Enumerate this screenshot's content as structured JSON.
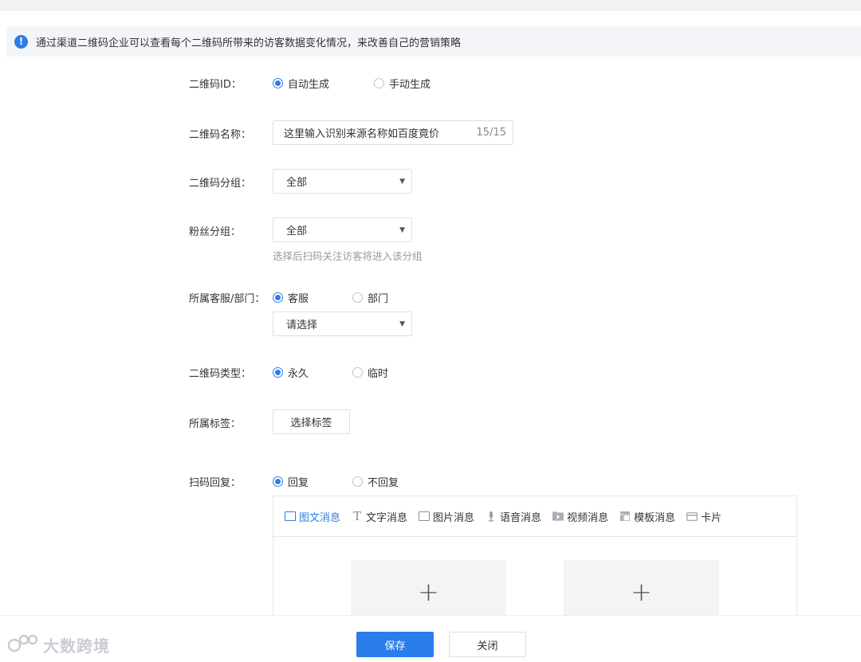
{
  "notice": {
    "text": "通过渠道二维码企业可以查看每个二维码所带来的访客数据变化情况，来改善自己的营销策略"
  },
  "form": {
    "qr_id": {
      "label": "二维码ID：",
      "options": [
        "自动生成",
        "手动生成"
      ],
      "selected": "自动生成"
    },
    "qr_name": {
      "label": "二维码名称：",
      "value": "这里输入识别来源名称如百度竟价",
      "count": "15/15"
    },
    "qr_group": {
      "label": "二维码分组：",
      "value": "全部"
    },
    "fan_group": {
      "label": "粉丝分组：",
      "value": "全部",
      "hint": "选择后扫码关注访客将进入该分组"
    },
    "service": {
      "label": "所属客服/部门：",
      "options": [
        "客服",
        "部门"
      ],
      "selected": "客服",
      "select_value": "请选择"
    },
    "qr_type": {
      "label": "二维码类型：",
      "options": [
        "永久",
        "临时"
      ],
      "selected": "永久"
    },
    "tags": {
      "label": "所属标签：",
      "button": "选择标签"
    },
    "reply": {
      "label": "扫码回复：",
      "options": [
        "回复",
        "不回复"
      ],
      "selected": "回复"
    }
  },
  "editor": {
    "tabs": [
      {
        "label": "图文消息",
        "icon": "news-icon",
        "active": true
      },
      {
        "label": "文字消息",
        "icon": "text-icon",
        "active": false
      },
      {
        "label": "图片消息",
        "icon": "image-icon",
        "active": false
      },
      {
        "label": "语音消息",
        "icon": "voice-icon",
        "active": false
      },
      {
        "label": "视频消息",
        "icon": "video-icon",
        "active": false
      },
      {
        "label": "模板消息",
        "icon": "template-icon",
        "active": false
      },
      {
        "label": "卡片",
        "icon": "card-icon",
        "active": false
      }
    ],
    "add_symbol": "+"
  },
  "footer": {
    "save": "保存",
    "close": "关闭"
  },
  "watermark": {
    "text": "大数跨境"
  },
  "colors": {
    "accent": "#2b7de9",
    "notice_bg": "#f3f5f8",
    "border": "#dcdfe6"
  }
}
